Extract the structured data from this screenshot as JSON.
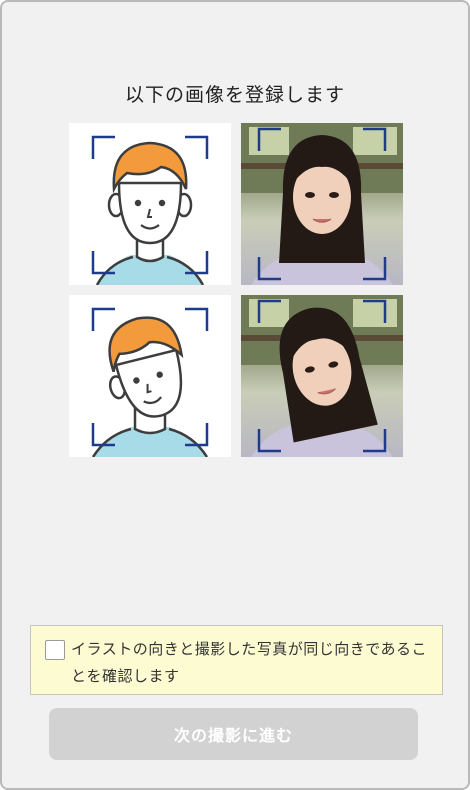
{
  "header": {
    "title": "以下の画像を登録します"
  },
  "faces": [
    {
      "illustration": "front-face-illustration",
      "photo": "front-face-photo"
    },
    {
      "illustration": "tilted-face-illustration",
      "photo": "tilted-face-photo"
    }
  ],
  "confirmation": {
    "checked": false,
    "text": "イラストの向きと撮影した写真が同じ向きであることを確認します"
  },
  "next_button": {
    "label": "次の撮影に進む",
    "enabled": false
  },
  "colors": {
    "frame_corner": "#1f3c8c",
    "hair": "#f29a3c",
    "shirt": "#a8dbe8",
    "notice_bg": "#fdfbd2",
    "disabled_button": "#d2d2d2"
  }
}
